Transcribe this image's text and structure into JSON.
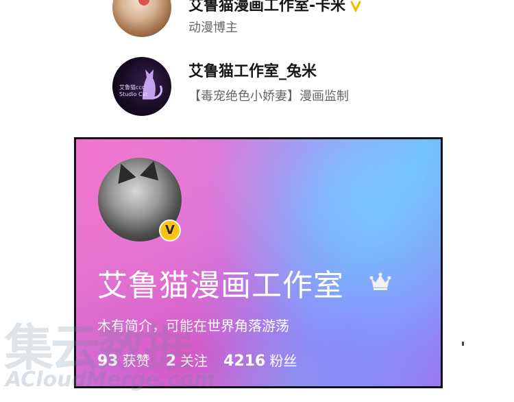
{
  "results": [
    {
      "name": "艾鲁猫漫画工作室-卡米",
      "subtitle": "动漫博主",
      "verified_icon": "verified-badge-icon"
    },
    {
      "name": "艾鲁猫工作室_兔米",
      "subtitle": "【毒宠绝色小娇妻】漫画监制",
      "avatar_text_line1": "艾鲁猫ccc",
      "avatar_text_line2": "Studio Cat"
    }
  ],
  "profile_card": {
    "name": "艾鲁猫漫画工作室",
    "verified_mark": "V",
    "bio": "木有简介，可能在世界角落游荡",
    "stats": [
      {
        "value": "93",
        "label": "获赞"
      },
      {
        "value": "2",
        "label": "关注"
      },
      {
        "value": "4216",
        "label": "粉丝"
      }
    ]
  },
  "watermark": {
    "chars": "集云数据",
    "text": "ACloudMerge.com"
  },
  "colors": {
    "verified_yellow": "#ffc315",
    "name_text": "#161616",
    "sub_text": "#666666"
  }
}
